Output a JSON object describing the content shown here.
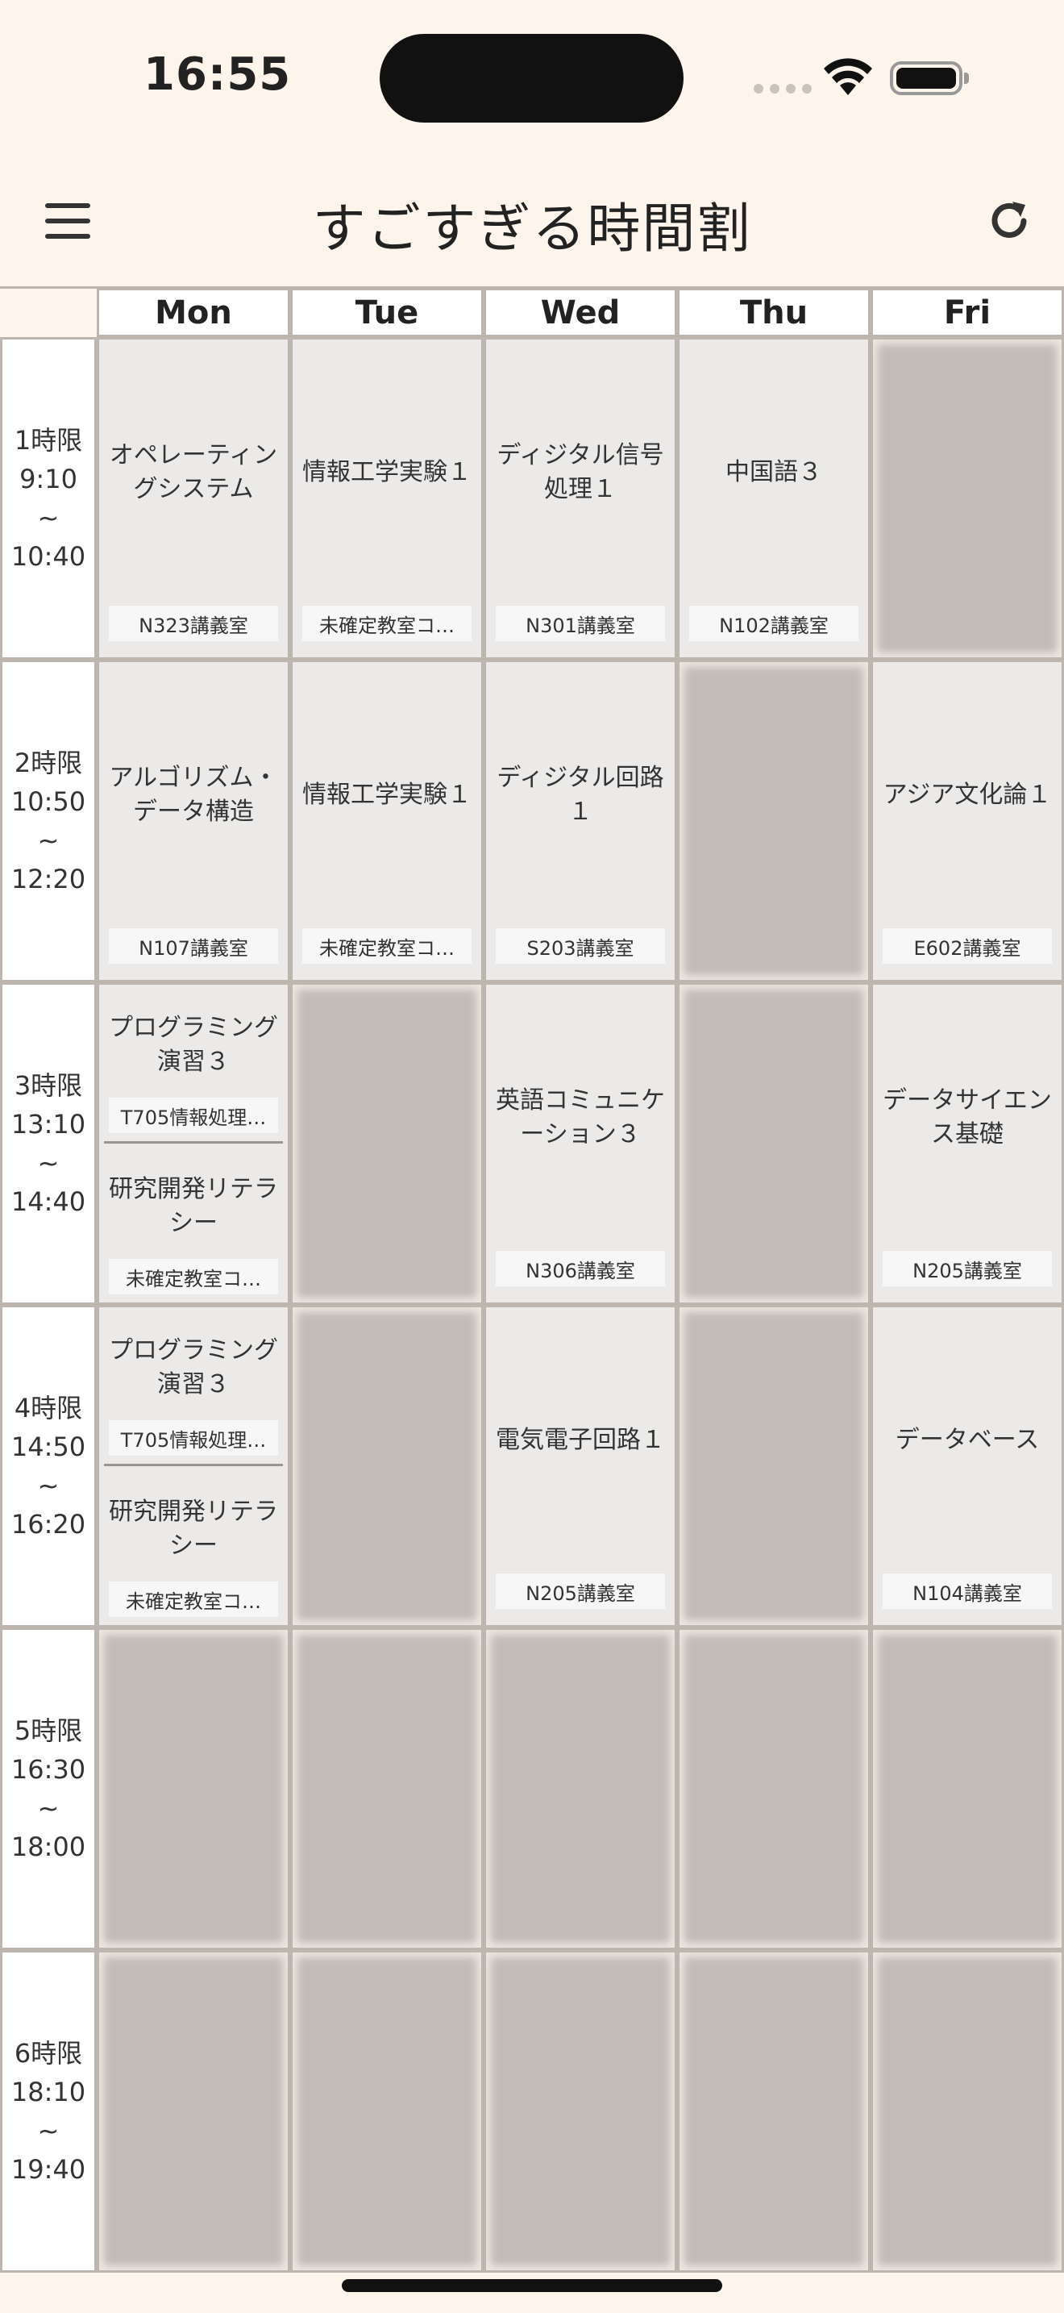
{
  "status_bar": {
    "time": "16:55"
  },
  "header": {
    "title": "すごすぎる時間割"
  },
  "days": [
    "Mon",
    "Tue",
    "Wed",
    "Thu",
    "Fri"
  ],
  "periods": [
    {
      "label": "1時限",
      "start": "9:10",
      "sep": "~",
      "end": "10:40"
    },
    {
      "label": "2時限",
      "start": "10:50",
      "sep": "~",
      "end": "12:20"
    },
    {
      "label": "3時限",
      "start": "13:10",
      "sep": "~",
      "end": "14:40"
    },
    {
      "label": "4時限",
      "start": "14:50",
      "sep": "~",
      "end": "16:20"
    },
    {
      "label": "5時限",
      "start": "16:30",
      "sep": "~",
      "end": "18:00"
    },
    {
      "label": "6時限",
      "start": "18:10",
      "sep": "~",
      "end": "19:40"
    }
  ],
  "cells": [
    [
      {
        "courses": [
          {
            "name": "オペレーティングシステム",
            "room": "N323講義室"
          }
        ]
      },
      {
        "courses": [
          {
            "name": "情報工学実験１",
            "room": "未確定教室コ…"
          }
        ]
      },
      {
        "courses": [
          {
            "name": "ディジタル信号処理１",
            "room": "N301講義室"
          }
        ]
      },
      {
        "courses": [
          {
            "name": "中国語３",
            "room": "N102講義室"
          }
        ]
      },
      {
        "courses": []
      }
    ],
    [
      {
        "courses": [
          {
            "name": "アルゴリズム・データ構造",
            "room": "N107講義室"
          }
        ]
      },
      {
        "courses": [
          {
            "name": "情報工学実験１",
            "room": "未確定教室コ…"
          }
        ]
      },
      {
        "courses": [
          {
            "name": "ディジタル回路１",
            "room": "S203講義室"
          }
        ]
      },
      {
        "courses": []
      },
      {
        "courses": [
          {
            "name": "アジア文化論１",
            "room": "E602講義室"
          }
        ]
      }
    ],
    [
      {
        "courses": [
          {
            "name": "プログラミング演習３",
            "room": "T705情報処理…"
          },
          {
            "name": "研究開発リテラシー",
            "room": "未確定教室コ…"
          }
        ]
      },
      {
        "courses": []
      },
      {
        "courses": [
          {
            "name": "英語コミュニケーション３",
            "room": "N306講義室"
          }
        ]
      },
      {
        "courses": []
      },
      {
        "courses": [
          {
            "name": "データサイエンス基礎",
            "room": "N205講義室"
          }
        ]
      }
    ],
    [
      {
        "courses": [
          {
            "name": "プログラミング演習３",
            "room": "T705情報処理…"
          },
          {
            "name": "研究開発リテラシー",
            "room": "未確定教室コ…"
          }
        ]
      },
      {
        "courses": []
      },
      {
        "courses": [
          {
            "name": "電気電子回路１",
            "room": "N205講義室"
          }
        ]
      },
      {
        "courses": []
      },
      {
        "courses": [
          {
            "name": "データベース",
            "room": "N104講義室"
          }
        ]
      }
    ],
    [
      {
        "courses": []
      },
      {
        "courses": []
      },
      {
        "courses": []
      },
      {
        "courses": []
      },
      {
        "courses": []
      }
    ],
    [
      {
        "courses": []
      },
      {
        "courses": []
      },
      {
        "courses": []
      },
      {
        "courses": []
      },
      {
        "courses": []
      }
    ]
  ]
}
